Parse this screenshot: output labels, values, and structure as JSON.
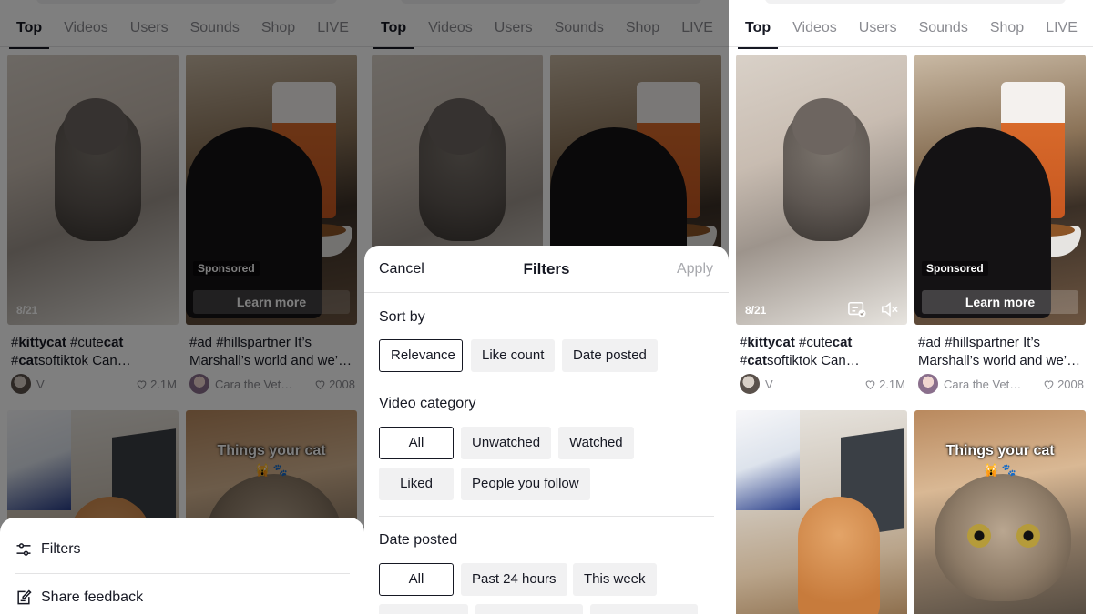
{
  "tabs": [
    "Top",
    "Videos",
    "Users",
    "Sounds",
    "Shop",
    "LIVE"
  ],
  "cards": [
    {
      "caption_parts": [
        {
          "t": "#",
          "b": false
        },
        {
          "t": "kittycat",
          "b": true
        },
        {
          "t": " #cute",
          "b": false
        },
        {
          "t": "cat",
          "b": true
        },
        {
          "t": " #",
          "b": false
        },
        {
          "t": "cat",
          "b": true
        },
        {
          "t": "softiktok Can something kitty please",
          "b": false
        }
      ],
      "author": "V",
      "likes": "2.1M",
      "counter": "8/21"
    },
    {
      "caption": "#ad #hillspartner It’s Marshall’s world and we’re just living in it",
      "author": "Cara the Vet…",
      "likes": "2008",
      "sponsored": "Sponsored",
      "learn_more": "Learn more"
    },
    {
      "overlay_text": "Things your cat",
      "overlay_emoji": "🙀 🐾"
    },
    {
      "overlay_text": "Things your cat",
      "overlay_emoji": "🙀 🐾"
    }
  ],
  "menu": {
    "filters": "Filters",
    "share_feedback": "Share feedback"
  },
  "filters_sheet": {
    "cancel": "Cancel",
    "title": "Filters",
    "apply": "Apply",
    "sort_by": {
      "title": "Sort by",
      "options": [
        "Relevance",
        "Like count",
        "Date posted"
      ],
      "selected": "Relevance"
    },
    "video_category": {
      "title": "Video category",
      "options": [
        "All",
        "Unwatched",
        "Watched",
        "Liked",
        "People you follow"
      ],
      "selected": "All"
    },
    "date_posted": {
      "title": "Date posted",
      "options": [
        "All",
        "Past 24 hours",
        "This week"
      ],
      "selected": "All"
    }
  },
  "colors": {
    "text": "#161823",
    "muted": "#8a8b91",
    "chip_bg": "#f1f1f2",
    "apply_disabled": "#a7a8ad"
  }
}
